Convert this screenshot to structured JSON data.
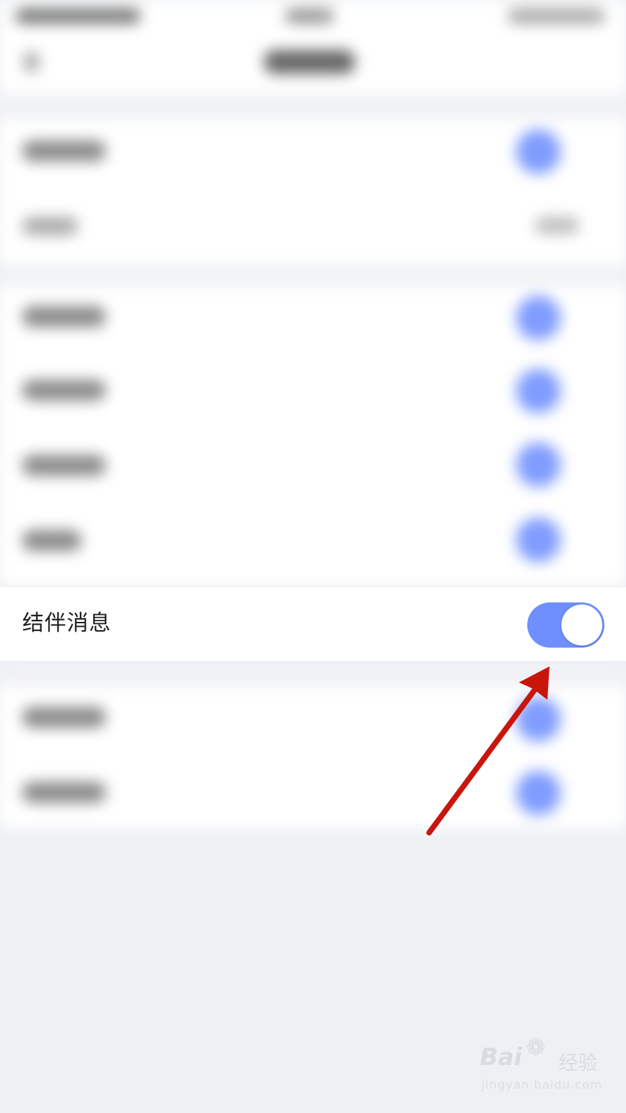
{
  "highlighted_row": {
    "label": "结伴消息",
    "toggle_state": "on"
  },
  "colors": {
    "toggle_on": "#6f8fff",
    "arrow": "#c8160c",
    "background": "#eef0f4"
  },
  "watermark": {
    "logo_text": "Bai",
    "logo_icon": "paw-icon",
    "logo_suffix": "经验",
    "url": "jingyan.baidu.com"
  }
}
